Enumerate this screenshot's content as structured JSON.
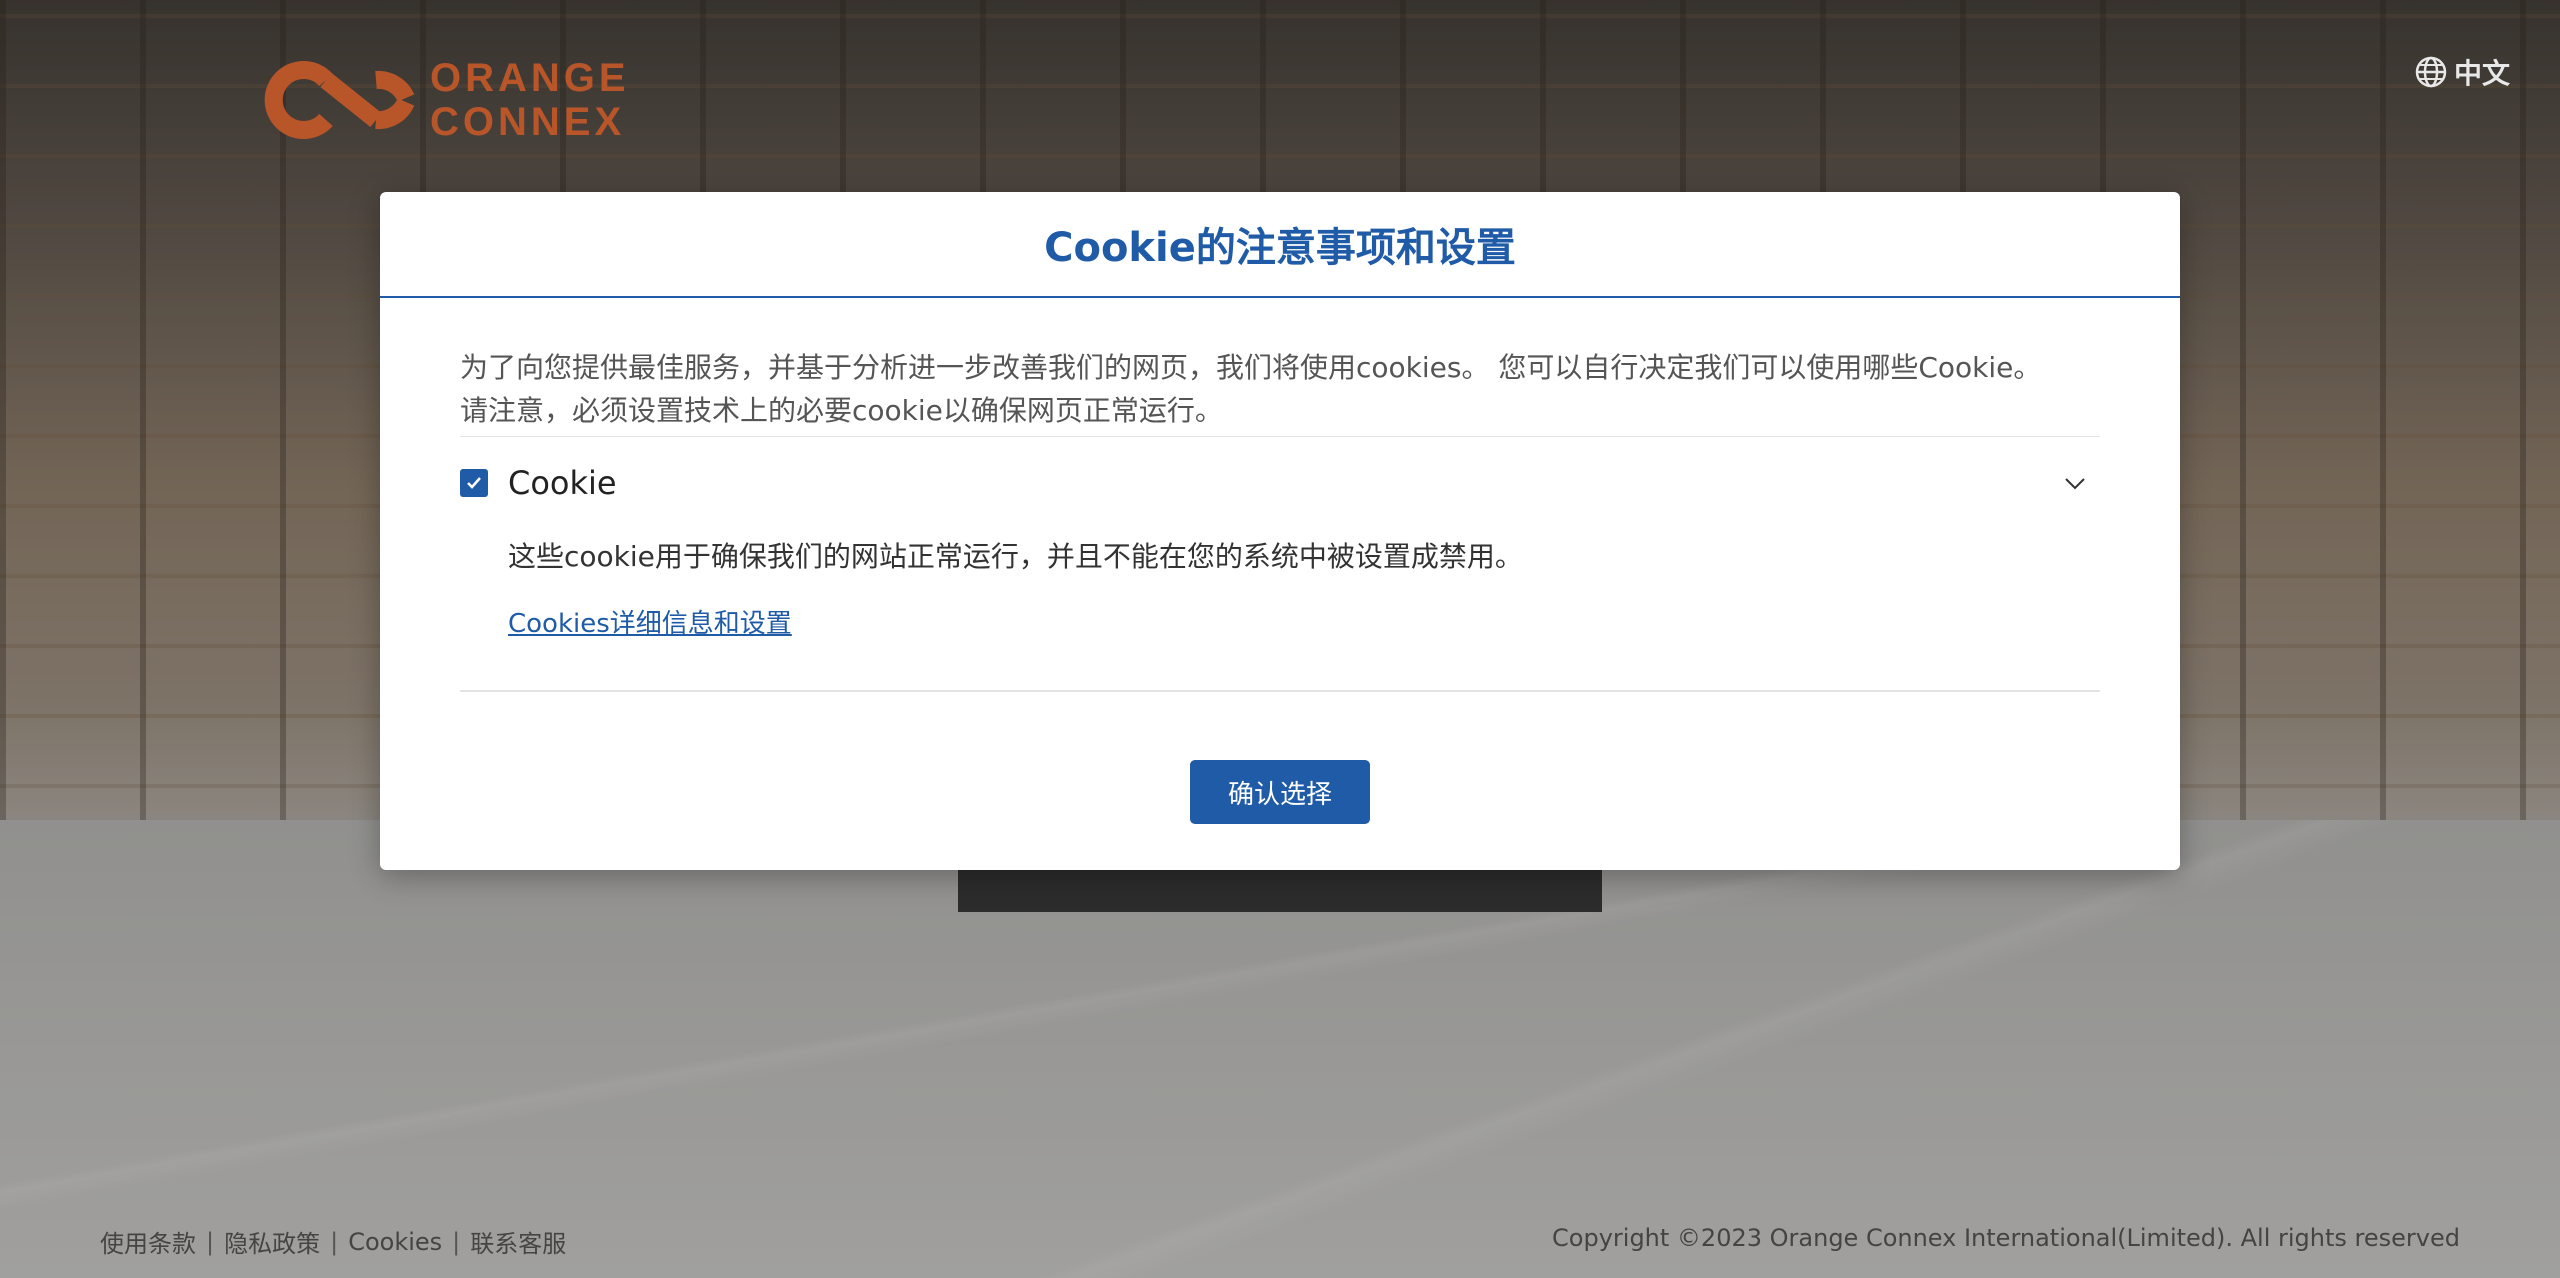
{
  "brand": {
    "name_line1": "ORANGE",
    "name_line2": "CONNEX",
    "color": "#b8562a"
  },
  "header": {
    "language_label": "中文",
    "language_icon": "globe-icon"
  },
  "cookie_modal": {
    "title": "Cookie的注意事项和设置",
    "intro_line1": "为了向您提供最佳服务，并基于分析进一步改善我们的网页，我们将使用cookies。 您可以自行决定我们可以使用哪些Cookie。",
    "intro_line2": "请注意，必须设置技术上的必要cookie以确保网页正常运行。",
    "category": {
      "label": "Cookie",
      "checked": true,
      "description": "这些cookie用于确保我们的网站正常运行，并且不能在您的系统中被设置成禁用。",
      "link_text": "Cookies详细信息和设置"
    },
    "confirm_label": "确认选择",
    "accent_color": "#1f5ba7"
  },
  "footer": {
    "links": [
      "使用条款",
      "隐私政策",
      "Cookies",
      "联系客服"
    ],
    "separator": "|",
    "copyright": "Copyright ©2023 Orange Connex International(Limited). All rights reserved"
  }
}
